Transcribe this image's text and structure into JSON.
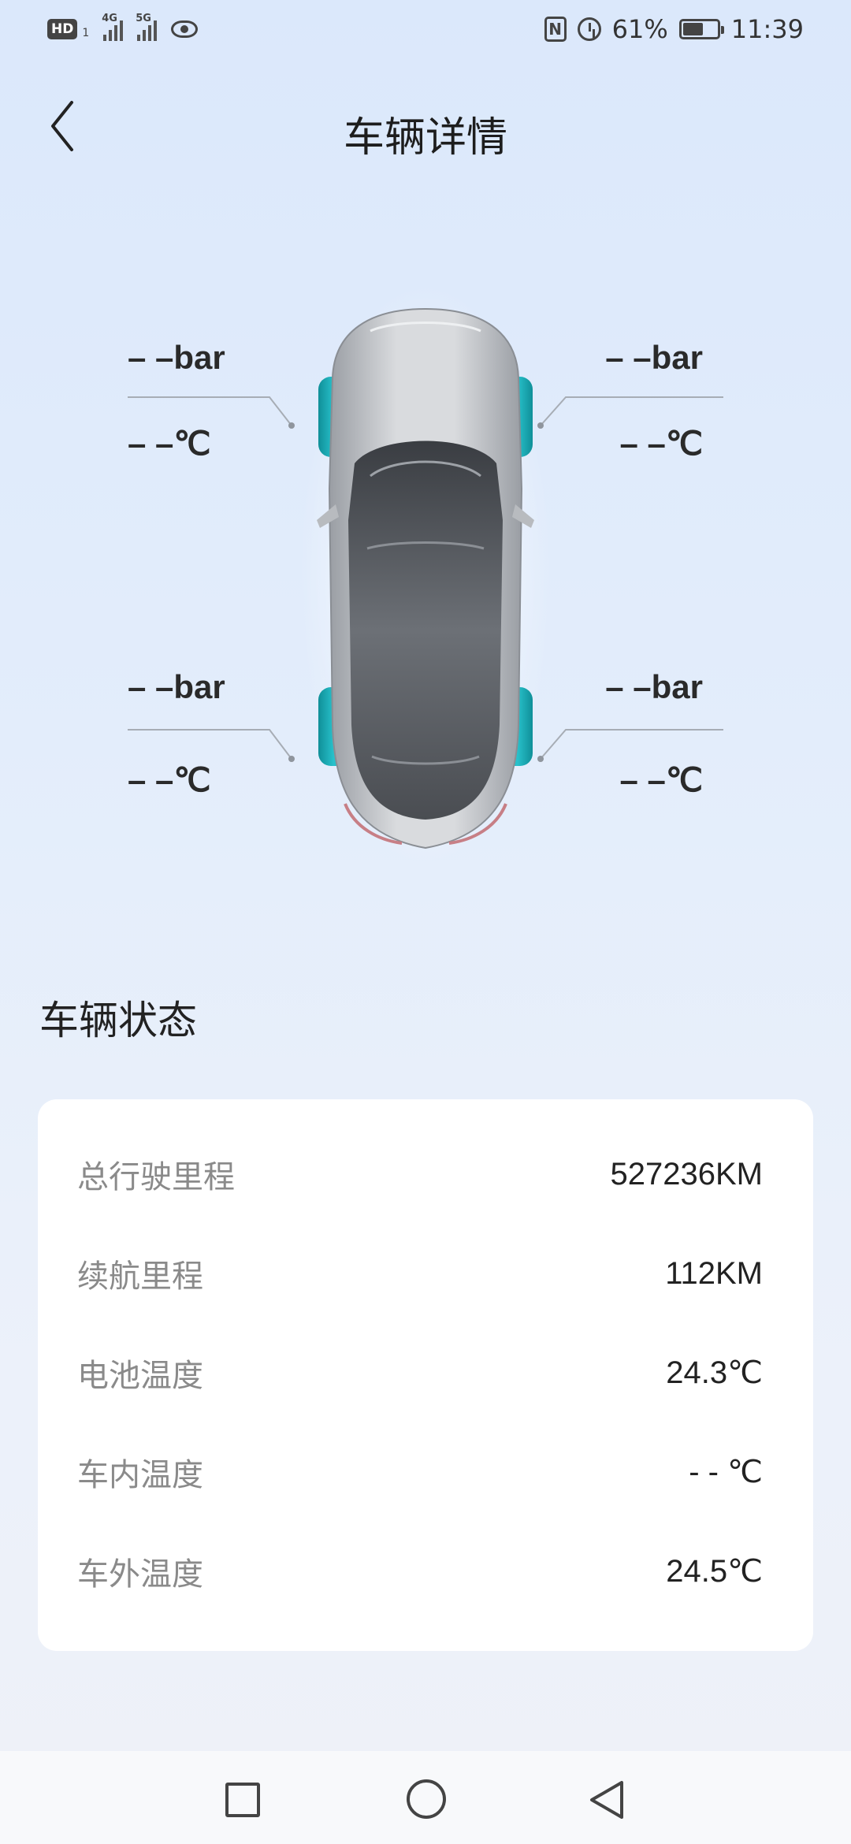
{
  "status_bar": {
    "hd_badge": "HD",
    "hd_sub": "1",
    "signal1_tag": "4G",
    "signal2_tag": "5G",
    "battery_percent": "61%",
    "battery_level": 0.61,
    "time": "11:39",
    "icons": [
      "hd-icon",
      "signal-4g-icon",
      "signal-5g-icon",
      "eye-icon",
      "nfc-icon",
      "alarm-icon",
      "battery-icon"
    ]
  },
  "header": {
    "title": "车辆详情",
    "back_icon": "chevron-left-icon"
  },
  "tires": {
    "front_left": {
      "pressure": "– –bar",
      "temp": "– –℃"
    },
    "front_right": {
      "pressure": "– –bar",
      "temp": "– –℃"
    },
    "rear_left": {
      "pressure": "– –bar",
      "temp": "– –℃"
    },
    "rear_right": {
      "pressure": "– –bar",
      "temp": "– –℃"
    },
    "highlight_color": "#1fb3bd"
  },
  "vehicle_status": {
    "title": "车辆状态",
    "rows": [
      {
        "label": "总行驶里程",
        "value": "527236KM"
      },
      {
        "label": "续航里程",
        "value": "112KM"
      },
      {
        "label": "电池温度",
        "value": "24.3℃"
      },
      {
        "label": "车内温度",
        "value": "- - ℃"
      },
      {
        "label": "车外温度",
        "value": "24.5℃"
      }
    ]
  },
  "nav_bar": {
    "icons": [
      "recent-apps-icon",
      "home-icon",
      "back-icon"
    ]
  }
}
